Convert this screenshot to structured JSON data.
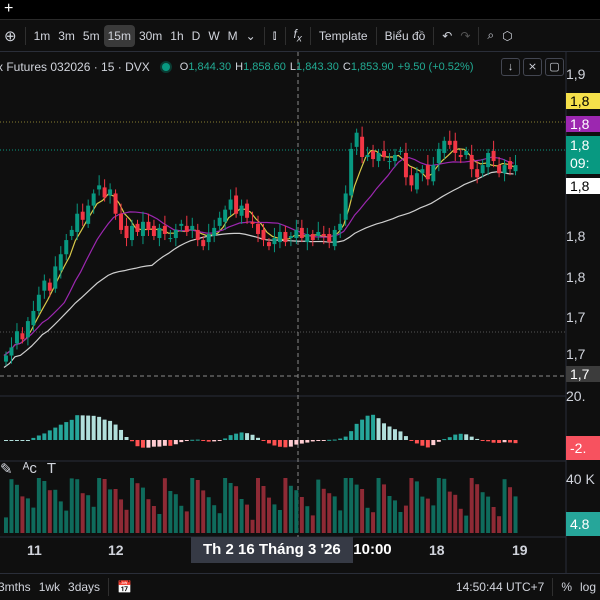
{
  "toolbar": {
    "timeframes": [
      "1m",
      "3m",
      "5m",
      "15m",
      "30m",
      "1h",
      "D",
      "W",
      "M"
    ],
    "active": "15m",
    "template": "Template",
    "chart_label": "Biểu đồ"
  },
  "legend": {
    "symbol": "x Futures 032026 · 15 · DVX",
    "o_label": "O",
    "o": "1,844.30",
    "h_label": "H",
    "h": "1,858.60",
    "l_label": "L",
    "l": "1,843.30",
    "c_label": "C",
    "c": "1,853.90",
    "change": "+9.50 (+0.52%)"
  },
  "price_axis": {
    "ticks": [
      "1,9",
      "1,8",
      "1,8",
      "1,7",
      "1,7"
    ],
    "tags": {
      "yellow": "1,8",
      "purple": "1,8",
      "last": "1,8",
      "countdown": "09:",
      "white": "1,8",
      "crosshair": "1,7"
    }
  },
  "macd_axis": {
    "top": "20.",
    "tag": "-2."
  },
  "volume_axis": {
    "top": "40 K",
    "tag": "4.8"
  },
  "time_axis": {
    "labels": [
      "11",
      "12",
      "18",
      "19"
    ],
    "crosshair": "Th 2 16 Tháng 3 '26   10:00"
  },
  "bottom": {
    "ranges": [
      "3mths",
      "1wk",
      "3days"
    ],
    "clock": "14:50:44 UTC+7",
    "pct": "%",
    "log": "log"
  },
  "colors": {
    "up": "#089981",
    "down": "#f23645",
    "ma_fast": "#d8c94a",
    "ma_mid": "#9c27b0",
    "ma_slow": "#cfcfcf"
  },
  "chart_data": {
    "type": "candlestick",
    "closes": [
      1768,
      1772,
      1780,
      1776,
      1785,
      1790,
      1798,
      1805,
      1800,
      1812,
      1818,
      1825,
      1830,
      1838,
      1835,
      1842,
      1848,
      1852,
      1846,
      1850,
      1838,
      1830,
      1826,
      1832,
      1829,
      1834,
      1830,
      1827,
      1831,
      1828,
      1826,
      1830,
      1833,
      1829,
      1832,
      1825,
      1822,
      1828,
      1831,
      1836,
      1840,
      1845,
      1838,
      1842,
      1836,
      1833,
      1828,
      1825,
      1822,
      1826,
      1829,
      1824,
      1827,
      1830,
      1826,
      1828,
      1825,
      1829,
      1827,
      1824,
      1830,
      1833,
      1848,
      1870,
      1878,
      1866,
      1867,
      1865,
      1868,
      1866,
      1864,
      1867,
      1869,
      1856,
      1852,
      1858,
      1860,
      1855,
      1862,
      1870,
      1874,
      1872,
      1868,
      1866,
      1869,
      1860,
      1856,
      1862,
      1868,
      1864,
      1858,
      1862,
      1860,
      1862
    ],
    "price_range": [
      1750,
      1905
    ]
  }
}
